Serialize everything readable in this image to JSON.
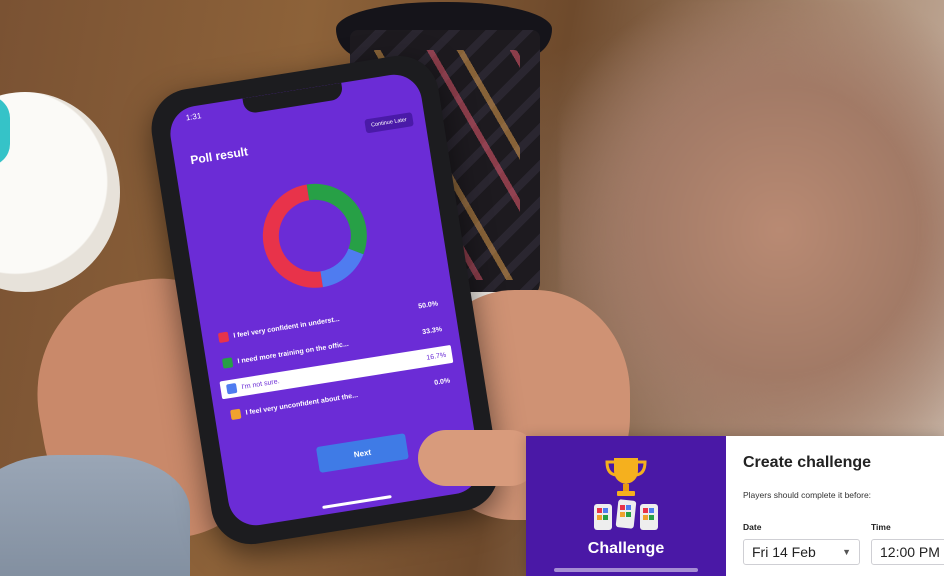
{
  "phone_app": {
    "status_time": "1:31",
    "title": "Poll result",
    "continue_label": "Continue Later",
    "answers": [
      {
        "text": "I feel very confident in underst...",
        "percent": "50.0%",
        "color": "#e8334a",
        "selected": false
      },
      {
        "text": "I need more training on the offic...",
        "percent": "33.3%",
        "color": "#27a046",
        "selected": false
      },
      {
        "text": "I'm not sure.",
        "percent": "16.7%",
        "color": "#4f7cf0",
        "selected": true
      },
      {
        "text": "I feel very unconfident about the...",
        "percent": "0.0%",
        "color": "#f0a22e",
        "selected": false
      }
    ],
    "next_label": "Next"
  },
  "chart_data": {
    "type": "pie",
    "categories": [
      "I feel very confident in underst...",
      "I need more training on the offic...",
      "I'm not sure.",
      "I feel very unconfident about the..."
    ],
    "values": [
      50.0,
      33.3,
      16.7,
      0.0
    ],
    "colors": [
      "#e8334a",
      "#27a046",
      "#4f7cf0",
      "#f0a22e"
    ],
    "style": "donut"
  },
  "challenge_card": {
    "panel_title": "Challenge",
    "heading": "Create challenge",
    "instruction": "Players should complete it before:",
    "date_label": "Date",
    "date_value": "Fri 14 Feb",
    "time_label": "Time",
    "time_value": "12:00 PM",
    "accent_color": "#4a18a6"
  }
}
